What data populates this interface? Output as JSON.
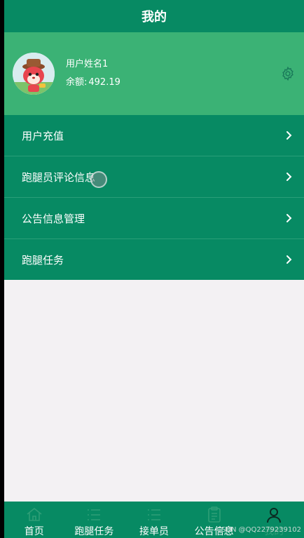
{
  "header": {
    "title": "我的"
  },
  "profile": {
    "username": "用户姓名1",
    "balance_label": "余额:",
    "balance_value": "492.19",
    "settings_icon": "gear-icon"
  },
  "menu": {
    "items": [
      {
        "label": "用户充值",
        "icon": "chevron-right-icon"
      },
      {
        "label": "跑腿员评论信息",
        "icon": "chevron-right-icon"
      },
      {
        "label": "公告信息管理",
        "icon": "chevron-right-icon"
      },
      {
        "label": "跑腿任务",
        "icon": "chevron-right-icon"
      }
    ]
  },
  "tabbar": {
    "items": [
      {
        "label": "首页",
        "icon": "home-icon"
      },
      {
        "label": "跑腿任务",
        "icon": "list-icon"
      },
      {
        "label": "接单员",
        "icon": "list-icon"
      },
      {
        "label": "公告信息",
        "icon": "clipboard-icon"
      },
      {
        "label": "我的",
        "icon": "user-icon",
        "active": true
      }
    ]
  },
  "watermark": "CSDN @QQ2279239102",
  "colors": {
    "primary": "#078a63",
    "profile_bg": "#3bb275",
    "content_bg": "#f3f1f3"
  }
}
